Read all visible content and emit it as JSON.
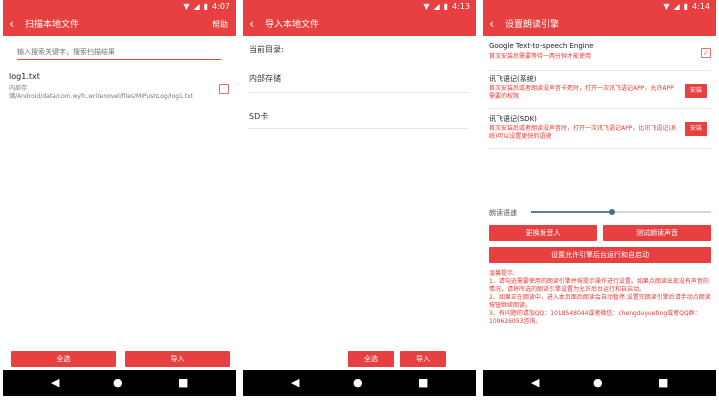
{
  "status": {
    "time_1": "4:07",
    "time_2": "4:13",
    "time_3": "4:14"
  },
  "screen1": {
    "title": "扫描本地文件",
    "help": "帮助",
    "search_placeholder": "输入搜索关键字，搜索扫描结果",
    "file_name": "log1.txt",
    "file_path": "内部存储/Android/data/com.wyfc.writenovel/files/MiPushLog/log1.txt",
    "select_all": "全选",
    "import": "导入"
  },
  "screen2": {
    "title": "导入本地文件",
    "current_dir_label": "当前目录:",
    "item_internal": "内部存储",
    "item_sd": "SD卡",
    "select_all": "全选",
    "import": "导入"
  },
  "screen3": {
    "title": "设置朗读引擎",
    "google_title": "Google Text-to-speech Engine",
    "google_desc": "首次安装后需要等待一两分钟才能使用",
    "xf_system_title": "讯飞语记(系统)",
    "xf_system_desc": "首次安装后或者朗读没声音卡死时，打开一次讯飞语记APP，允许APP需要的权限",
    "xf_sdk_title": "讯飞语记(SDK)",
    "xf_sdk_desc": "首次安装后或者朗读没声音时，打开一次讯飞语记APP，比讯飞语记(系统)可以设置更快的语速",
    "install_label": "安装",
    "speed_label": "朗读语速",
    "speed_fraction": 0.45,
    "btn_change_voice": "更换发音人",
    "btn_test": "测试朗读声音",
    "btn_background": "设置允许引擎后台运行和自启动",
    "tips_title": "温馨提示:",
    "tips_1": "1、请勾选需要使用的朗读引擎并按提示操作进行设置。如果点朗读出现没有声音的情况，请将所选的朗读引擎设置为允许后台运行和自启动。",
    "tips_2": "2、如果正在朗读中，进入本页面后朗读会自动暂停,设置完朗读引擎后请手动点朗读按钮继续朗读。",
    "tips_3": "3、有问题的请加QQ：1018548044或者微信：chengduyueting或者QQ群：109626053咨询。"
  },
  "colors": {
    "accent": "#e84040",
    "tip_red": "#e53935"
  },
  "icons": {
    "back": "back-arrow-icon",
    "wifi": "wifi-icon",
    "signal": "signal-icon",
    "battery": "battery-icon",
    "nav_back": "nav-back-icon",
    "nav_home": "nav-home-icon",
    "nav_recent": "nav-recent-icon"
  }
}
